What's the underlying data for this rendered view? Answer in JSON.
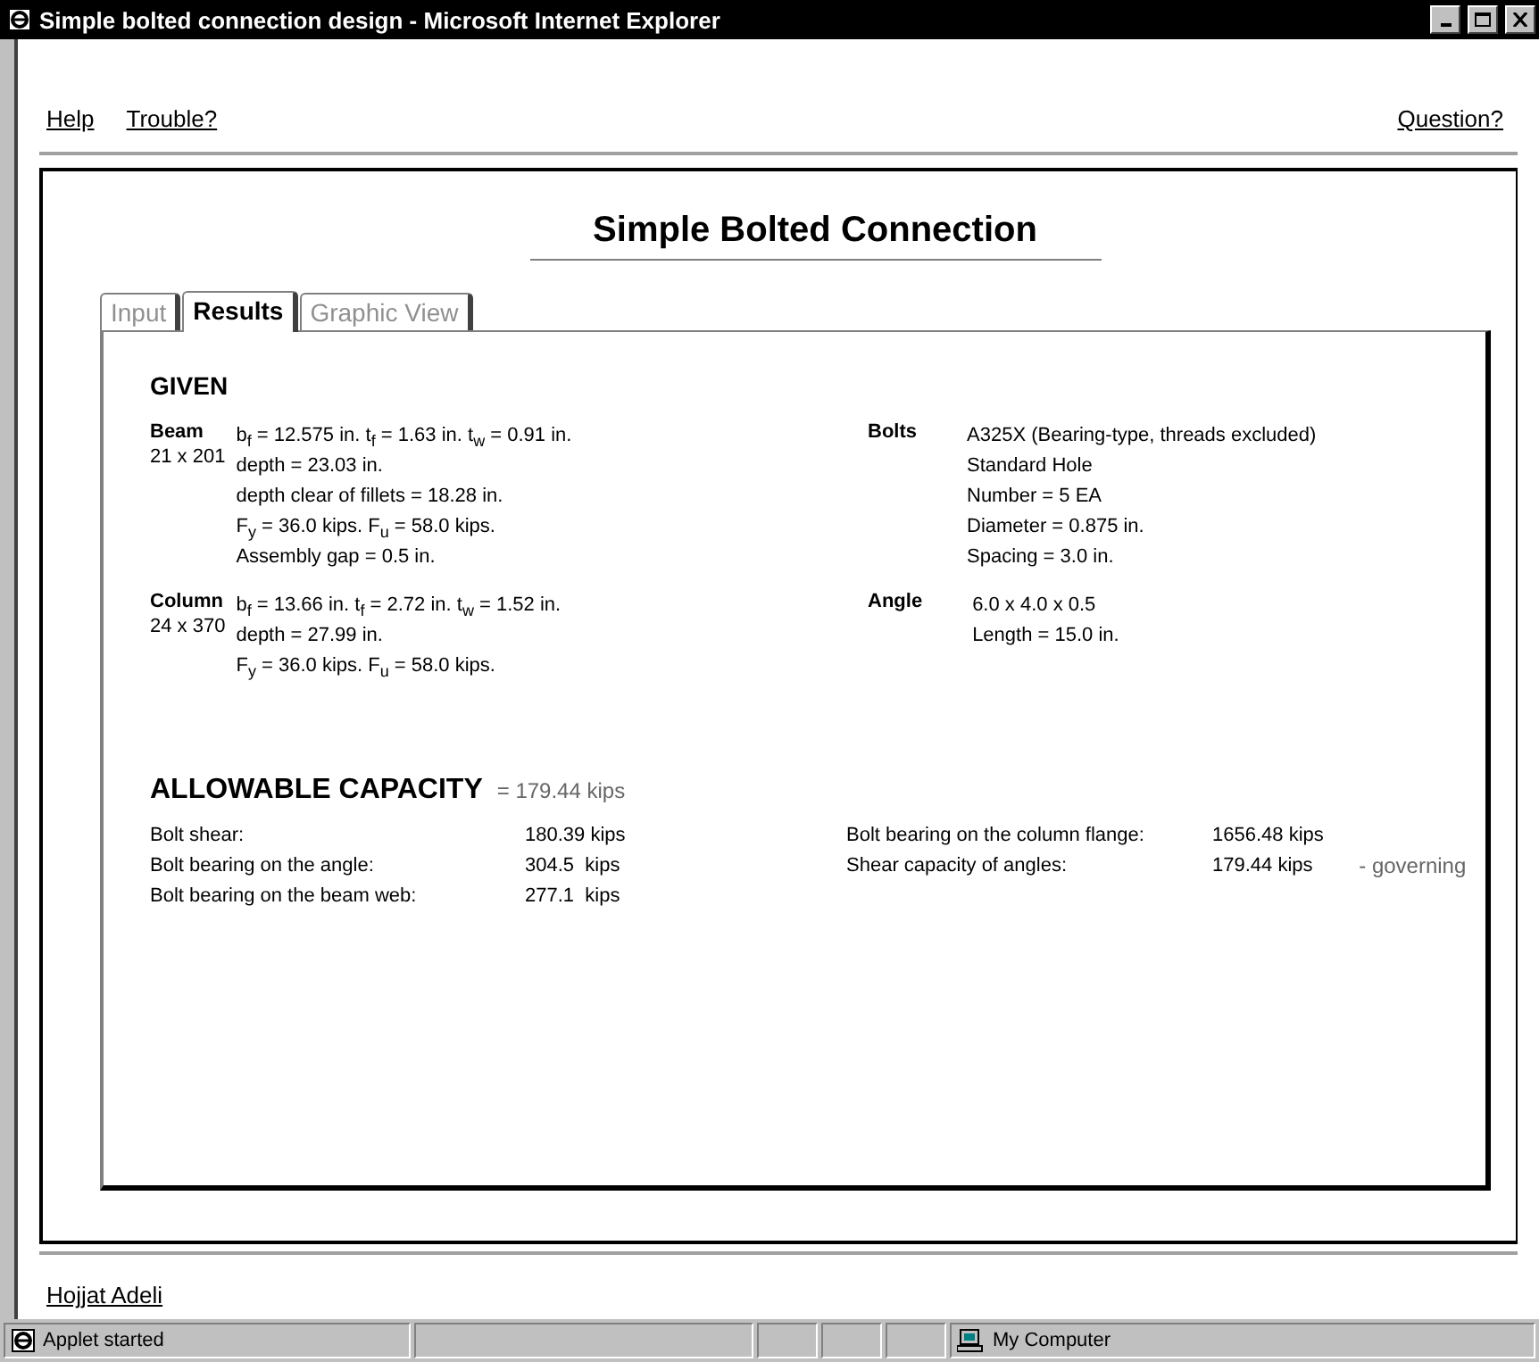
{
  "window": {
    "title": "Simple bolted connection design - Microsoft Internet Explorer"
  },
  "links": {
    "left": [
      "Help",
      "Trouble?"
    ],
    "right": "Question?"
  },
  "heading": "Simple Bolted Connection",
  "tabs": [
    {
      "label": "Input",
      "selected": false
    },
    {
      "label": "Results",
      "selected": true
    },
    {
      "label": "Graphic View",
      "selected": false
    }
  ],
  "given": {
    "title": "GIVEN",
    "left": [
      {
        "name": "Beam",
        "size": "21 x 201",
        "lines": [
          "b$_{f}$ = 12.575 in.  t$_{f}$ = 1.63 in.  t$_{w}$ = 0.91 in.",
          "depth = 23.03 in.",
          "depth clear of fillets = 18.28 in.",
          "F$_{y}$ = 36.0 kips.  F$_{u}$ = 58.0 kips.",
          "Assembly gap = 0.5 in."
        ]
      },
      {
        "name": "Column",
        "size": "24 x 370",
        "lines": [
          "b$_{f}$ = 13.66 in.  t$_{f}$ = 2.72 in.  t$_{w}$ = 1.52 in.",
          "depth = 27.99 in.",
          "F$_{y}$ = 36.0 kips.  F$_{u}$ = 58.0 kips."
        ]
      }
    ],
    "right": [
      {
        "name": "Bolts",
        "lines": [
          "A325X (Bearing-type, threads excluded)",
          "Standard Hole",
          "Number = 5 EA",
          "Diameter = 0.875 in.",
          "Spacing = 3.0 in."
        ]
      },
      {
        "name": "Angle",
        "lines": [
          "6.0 x 4.0 x 0.5",
          "Length = 15.0 in."
        ]
      }
    ]
  },
  "capacity": {
    "title": "ALLOWABLE CAPACITY",
    "total": "= 179.44 kips",
    "left": [
      {
        "label": "Bolt shear:",
        "value": "180.39 kips"
      },
      {
        "label": "Bolt bearing on the angle:",
        "value": "304.5  kips"
      },
      {
        "label": "Bolt bearing on the beam web:",
        "value": "277.1  kips"
      }
    ],
    "right": [
      {
        "label": "Bolt bearing on the column flange:",
        "value": "1656.48 kips"
      },
      {
        "label": "Shear capacity of angles:",
        "value": "179.44 kips",
        "note": "- governing"
      }
    ]
  },
  "footer": {
    "author": "Hojjat Adeli"
  },
  "status_bar": {
    "message": "Applet started",
    "zone": "My Computer"
  }
}
